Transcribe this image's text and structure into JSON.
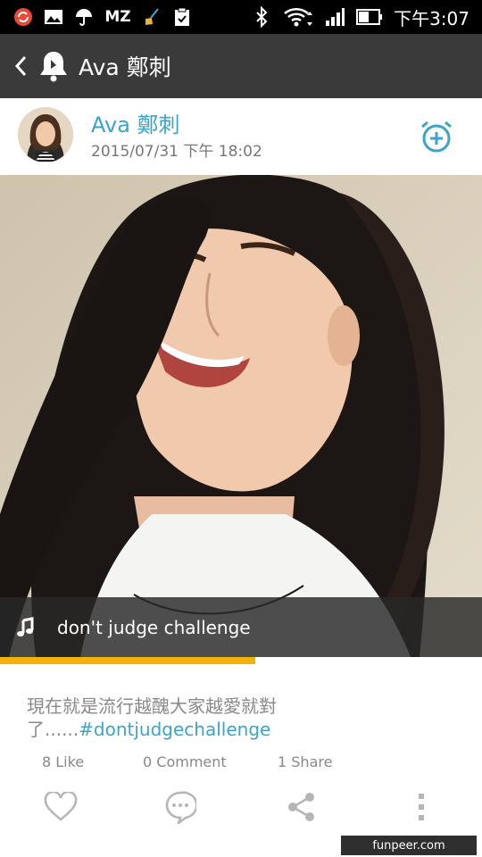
{
  "status_bar": {
    "icons": [
      "sync-icon",
      "gallery-icon",
      "umbrella-icon",
      "mz-icon",
      "broom-icon",
      "clipboard-check-icon",
      "bluetooth-icon",
      "wifi-icon",
      "signal-icon",
      "battery-icon"
    ],
    "mz_label": "MZ",
    "time": "下午3:07"
  },
  "app_bar": {
    "title": "Ava 鄭刺"
  },
  "post": {
    "author": "Ava 鄭刺",
    "timestamp": "2015/07/31 下午 18:02",
    "song_title": "don't judge challenge",
    "progress": 0.53,
    "caption_text": "現在就是流行越醜大家越愛就對了......",
    "hashtag": "#dontjudgechallenge",
    "likes": "8 Like",
    "comments": "0 Comment",
    "shares": "1 Share"
  },
  "colors": {
    "accent": "#3aa4c9",
    "progress": "#f3b20b",
    "app_bar": "#3a3a3a"
  },
  "watermark": "funpeer.com"
}
